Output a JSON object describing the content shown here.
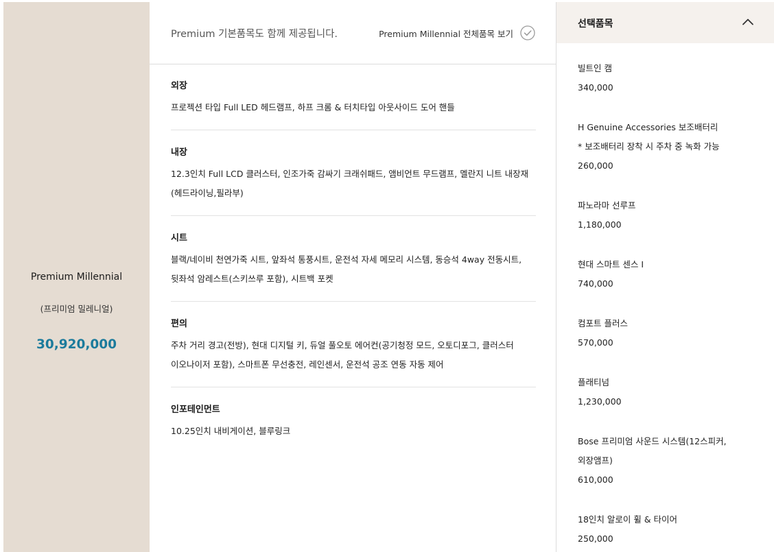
{
  "trim": {
    "name": "Premium Millennial",
    "name_kor": "(프리미엄 밀레니얼)",
    "price": "30,920,000"
  },
  "basic": {
    "notice": "Premium 기본품목도 함께 제공됩니다.",
    "view_all_label": "Premium Millennial 전체품목 보기",
    "icon": "check-circle-icon",
    "sections": [
      {
        "title": "외장",
        "lines": [
          "프로젝션 타입 Full LED 헤드램프, 하프 크롬 & 터치타입 아웃사이드 도어 핸들"
        ]
      },
      {
        "title": "내장",
        "lines": [
          "12.3인치 Full LCD 클러스터, 인조가죽 감싸기 크래쉬패드, 앰비언트 무드램프, 멜란지 니트 내장재",
          "(헤드라이닝,필라부)"
        ]
      },
      {
        "title": "시트",
        "lines": [
          "블랙/네이비 천연가죽 시트, 앞좌석 통풍시트, 운전석 자세 메모리 시스템, 동승석 4way 전동시트,",
          "뒷좌석 암레스트(스키쓰루 포함), 시트백 포켓"
        ]
      },
      {
        "title": "편의",
        "lines": [
          "주차 거리 경고(전방), 현대 디지털 키, 듀얼 풀오토 에어컨(공기청정 모드, 오토디포그, 클러스터",
          "이오나이저 포함), 스마트폰 무선충전, 레인센서, 운전석 공조 연동 자동 제어"
        ]
      },
      {
        "title": "인포테인먼트",
        "lines": [
          "10.25인치 내비게이션, 블루링크"
        ]
      }
    ]
  },
  "selected": {
    "title": "선택품목",
    "icon": "chevron-up-icon",
    "options": [
      {
        "lines": [
          "빌트인 캠"
        ],
        "price": "340,000"
      },
      {
        "lines": [
          "H Genuine Accessories 보조배터리",
          "* 보조배터리 장착 시 주차 중 녹화 가능"
        ],
        "price": "260,000"
      },
      {
        "lines": [
          "파노라마 선루프"
        ],
        "price": "1,180,000"
      },
      {
        "lines": [
          "현대 스마트 센스 Ⅰ"
        ],
        "price": "740,000"
      },
      {
        "lines": [
          "컴포트 플러스"
        ],
        "price": "570,000"
      },
      {
        "lines": [
          "플래티넘"
        ],
        "price": "1,230,000"
      },
      {
        "lines": [
          "Bose 프리미엄 사운드 시스템(12스피커,",
          "외장앰프)"
        ],
        "price": "610,000"
      },
      {
        "lines": [
          "18인치 알로이 휠 & 타이어"
        ],
        "price": "250,000"
      }
    ]
  },
  "colors": {
    "trim_panel_bg": "#e5dcd2",
    "price_accent": "#1c7b9c",
    "selected_header_bg": "#f5f1ed"
  }
}
